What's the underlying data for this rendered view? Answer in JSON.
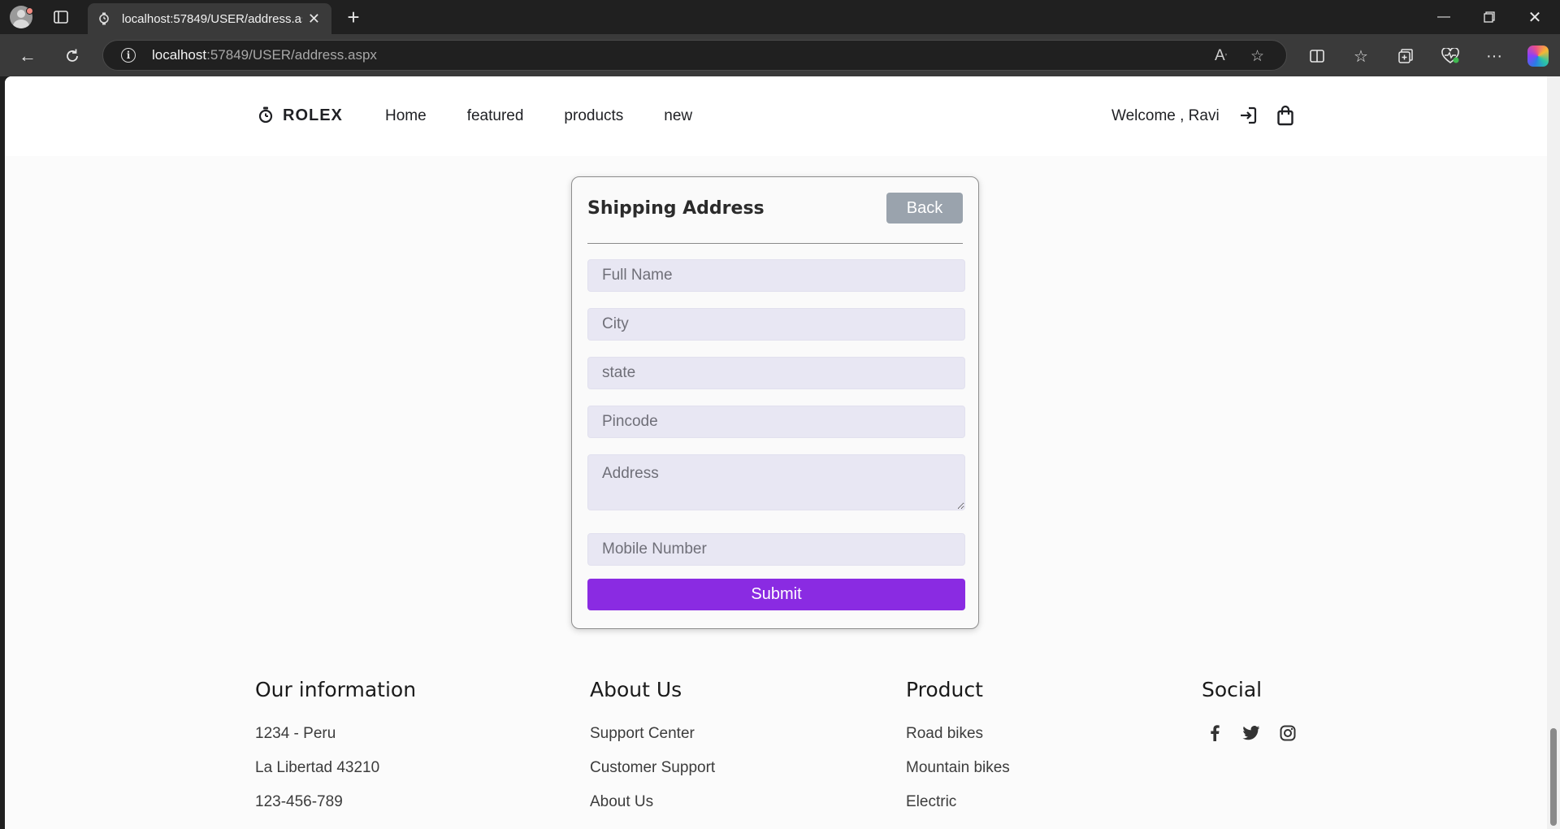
{
  "browser": {
    "tab_title": "localhost:57849/USER/address.aspx",
    "url_host": "localhost",
    "url_rest": ":57849/USER/address.aspx"
  },
  "header": {
    "brand": "ROLEX",
    "nav": [
      "Home",
      "featured",
      "products",
      "new"
    ],
    "welcome": "Welcome , Ravi"
  },
  "form": {
    "title": "Shipping Address",
    "back_label": "Back",
    "placeholders": {
      "full_name": "Full Name",
      "city": "City",
      "state": "state",
      "pincode": "Pincode",
      "address": "Address",
      "mobile": "Mobile Number"
    },
    "submit_label": "Submit"
  },
  "footer": {
    "our_information": {
      "title": "Our information",
      "items": [
        "1234 - Peru",
        "La Libertad 43210",
        "123-456-789"
      ]
    },
    "about_us": {
      "title": "About Us",
      "items": [
        "Support Center",
        "Customer Support",
        "About Us"
      ]
    },
    "product": {
      "title": "Product",
      "items": [
        "Road bikes",
        "Mountain bikes",
        "Electric"
      ]
    },
    "social": {
      "title": "Social",
      "icons": [
        "facebook-icon",
        "twitter-icon",
        "instagram-icon"
      ]
    }
  },
  "colors": {
    "accent": "#8a2be2",
    "back_button": "#9aa3ad",
    "input_bg": "#e8e7f3"
  }
}
